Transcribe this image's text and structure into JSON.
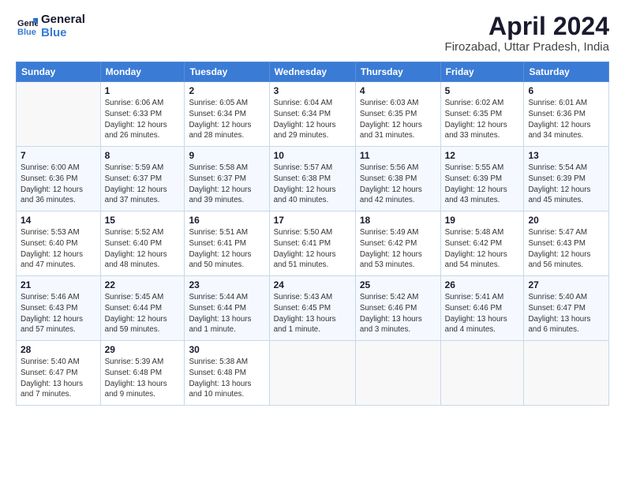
{
  "header": {
    "logo_line1": "General",
    "logo_line2": "Blue",
    "title": "April 2024",
    "subtitle": "Firozabad, Uttar Pradesh, India"
  },
  "weekdays": [
    "Sunday",
    "Monday",
    "Tuesday",
    "Wednesday",
    "Thursday",
    "Friday",
    "Saturday"
  ],
  "weeks": [
    [
      {
        "day": "",
        "info": ""
      },
      {
        "day": "1",
        "info": "Sunrise: 6:06 AM\nSunset: 6:33 PM\nDaylight: 12 hours\nand 26 minutes."
      },
      {
        "day": "2",
        "info": "Sunrise: 6:05 AM\nSunset: 6:34 PM\nDaylight: 12 hours\nand 28 minutes."
      },
      {
        "day": "3",
        "info": "Sunrise: 6:04 AM\nSunset: 6:34 PM\nDaylight: 12 hours\nand 29 minutes."
      },
      {
        "day": "4",
        "info": "Sunrise: 6:03 AM\nSunset: 6:35 PM\nDaylight: 12 hours\nand 31 minutes."
      },
      {
        "day": "5",
        "info": "Sunrise: 6:02 AM\nSunset: 6:35 PM\nDaylight: 12 hours\nand 33 minutes."
      },
      {
        "day": "6",
        "info": "Sunrise: 6:01 AM\nSunset: 6:36 PM\nDaylight: 12 hours\nand 34 minutes."
      }
    ],
    [
      {
        "day": "7",
        "info": "Sunrise: 6:00 AM\nSunset: 6:36 PM\nDaylight: 12 hours\nand 36 minutes."
      },
      {
        "day": "8",
        "info": "Sunrise: 5:59 AM\nSunset: 6:37 PM\nDaylight: 12 hours\nand 37 minutes."
      },
      {
        "day": "9",
        "info": "Sunrise: 5:58 AM\nSunset: 6:37 PM\nDaylight: 12 hours\nand 39 minutes."
      },
      {
        "day": "10",
        "info": "Sunrise: 5:57 AM\nSunset: 6:38 PM\nDaylight: 12 hours\nand 40 minutes."
      },
      {
        "day": "11",
        "info": "Sunrise: 5:56 AM\nSunset: 6:38 PM\nDaylight: 12 hours\nand 42 minutes."
      },
      {
        "day": "12",
        "info": "Sunrise: 5:55 AM\nSunset: 6:39 PM\nDaylight: 12 hours\nand 43 minutes."
      },
      {
        "day": "13",
        "info": "Sunrise: 5:54 AM\nSunset: 6:39 PM\nDaylight: 12 hours\nand 45 minutes."
      }
    ],
    [
      {
        "day": "14",
        "info": "Sunrise: 5:53 AM\nSunset: 6:40 PM\nDaylight: 12 hours\nand 47 minutes."
      },
      {
        "day": "15",
        "info": "Sunrise: 5:52 AM\nSunset: 6:40 PM\nDaylight: 12 hours\nand 48 minutes."
      },
      {
        "day": "16",
        "info": "Sunrise: 5:51 AM\nSunset: 6:41 PM\nDaylight: 12 hours\nand 50 minutes."
      },
      {
        "day": "17",
        "info": "Sunrise: 5:50 AM\nSunset: 6:41 PM\nDaylight: 12 hours\nand 51 minutes."
      },
      {
        "day": "18",
        "info": "Sunrise: 5:49 AM\nSunset: 6:42 PM\nDaylight: 12 hours\nand 53 minutes."
      },
      {
        "day": "19",
        "info": "Sunrise: 5:48 AM\nSunset: 6:42 PM\nDaylight: 12 hours\nand 54 minutes."
      },
      {
        "day": "20",
        "info": "Sunrise: 5:47 AM\nSunset: 6:43 PM\nDaylight: 12 hours\nand 56 minutes."
      }
    ],
    [
      {
        "day": "21",
        "info": "Sunrise: 5:46 AM\nSunset: 6:43 PM\nDaylight: 12 hours\nand 57 minutes."
      },
      {
        "day": "22",
        "info": "Sunrise: 5:45 AM\nSunset: 6:44 PM\nDaylight: 12 hours\nand 59 minutes."
      },
      {
        "day": "23",
        "info": "Sunrise: 5:44 AM\nSunset: 6:44 PM\nDaylight: 13 hours\nand 1 minute."
      },
      {
        "day": "24",
        "info": "Sunrise: 5:43 AM\nSunset: 6:45 PM\nDaylight: 13 hours\nand 1 minute."
      },
      {
        "day": "25",
        "info": "Sunrise: 5:42 AM\nSunset: 6:46 PM\nDaylight: 13 hours\nand 3 minutes."
      },
      {
        "day": "26",
        "info": "Sunrise: 5:41 AM\nSunset: 6:46 PM\nDaylight: 13 hours\nand 4 minutes."
      },
      {
        "day": "27",
        "info": "Sunrise: 5:40 AM\nSunset: 6:47 PM\nDaylight: 13 hours\nand 6 minutes."
      }
    ],
    [
      {
        "day": "28",
        "info": "Sunrise: 5:40 AM\nSunset: 6:47 PM\nDaylight: 13 hours\nand 7 minutes."
      },
      {
        "day": "29",
        "info": "Sunrise: 5:39 AM\nSunset: 6:48 PM\nDaylight: 13 hours\nand 9 minutes."
      },
      {
        "day": "30",
        "info": "Sunrise: 5:38 AM\nSunset: 6:48 PM\nDaylight: 13 hours\nand 10 minutes."
      },
      {
        "day": "",
        "info": ""
      },
      {
        "day": "",
        "info": ""
      },
      {
        "day": "",
        "info": ""
      },
      {
        "day": "",
        "info": ""
      }
    ]
  ]
}
